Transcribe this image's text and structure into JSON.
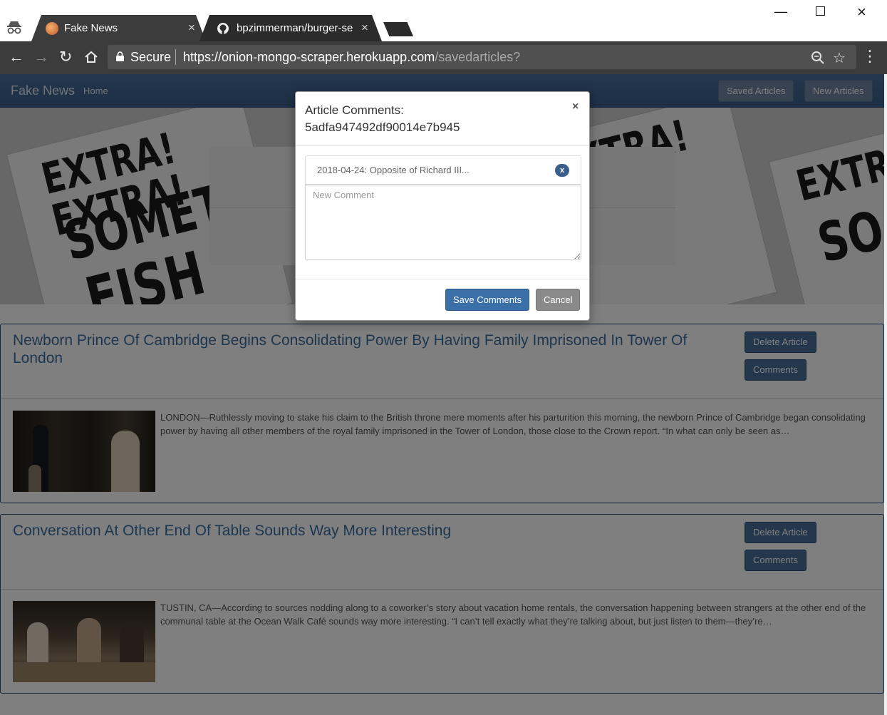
{
  "browser": {
    "tabs": [
      {
        "title": "Fake News",
        "active": true
      },
      {
        "title": "bpzimmerman/burger-se",
        "active": false
      }
    ],
    "secure_label": "Secure",
    "url_host": "https://onion-mongo-scraper.herokuapp.com",
    "url_path": "/savedarticles?"
  },
  "navbar": {
    "brand": "Fake News",
    "home": "Home",
    "saved_articles": "Saved Articles",
    "new_articles": "New Articles"
  },
  "articles": [
    {
      "title": "Newborn Prince Of Cambridge Begins Consolidating Power By Having Family Imprisoned In Tower Of London",
      "delete_label": "Delete Article",
      "comments_label": "Comments",
      "summary": "LONDON—Ruthlessly moving to stake his claim to the British throne mere moments after his parturition this morning, the newborn Prince of Cambridge began consolidating power by having all other members of the royal family imprisoned in the Tower of London, those close to the Crown report. “In what can only be seen as…"
    },
    {
      "title": "Conversation At Other End Of Table Sounds Way More Interesting",
      "delete_label": "Delete Article",
      "comments_label": "Comments",
      "summary": "TUSTIN, CA—According to sources nodding along to a coworker’s story about vacation home rentals, the conversation happening between strangers at the other end of the communal table at the Ocean Walk Café sounds way more interesting. “I can’t tell exactly what they’re talking about, but just listen to them—they’re…"
    }
  ],
  "modal": {
    "title": "Article Comments: 5adfa947492df90014e7b945",
    "close": "×",
    "comment": "2018-04-24: Opposite of Richard III...",
    "comment_delete": "x",
    "new_comment_placeholder": "New Comment",
    "save_label": "Save Comments",
    "cancel_label": "Cancel"
  },
  "colors": {
    "navbar": "#3b5f8b",
    "primary_button": "#4a6e9a",
    "chrome_toolbar": "#3c3c3c"
  }
}
